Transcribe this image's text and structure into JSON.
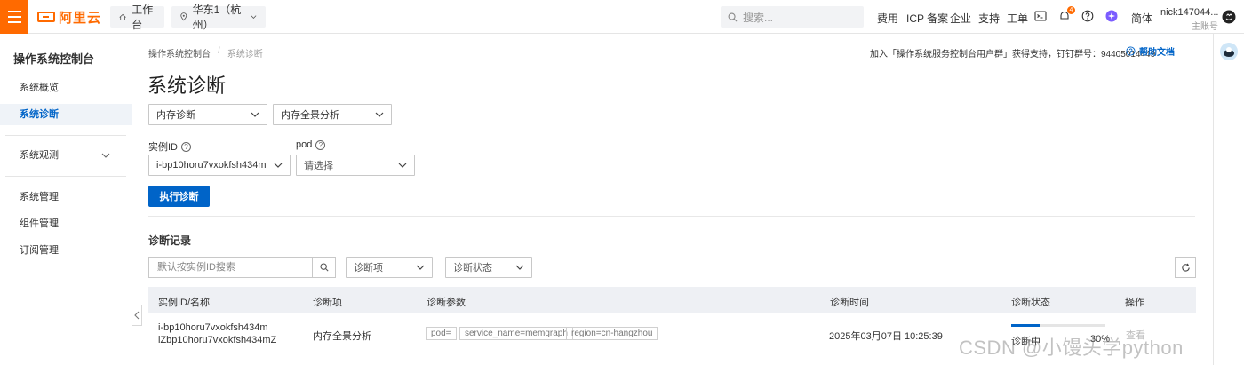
{
  "topbar": {
    "logo_text": "阿里云",
    "home_label": "工作台",
    "region_label": "华东1（杭州）",
    "search_placeholder": "搜索...",
    "links": [
      "费用",
      "ICP 备案",
      "企业",
      "支持",
      "工单"
    ],
    "notification_count": "4",
    "lang_label": "简体",
    "user_name": "nick147044...",
    "user_role": "主账号",
    "accent_color": "#ff6a00"
  },
  "sidebar": {
    "title": "操作系统控制台",
    "items": [
      {
        "label": "系统概览",
        "active": false
      },
      {
        "label": "系统诊断",
        "active": true
      },
      {
        "label": "系统观测",
        "active": false,
        "expandable": true
      },
      {
        "label": "系统管理",
        "active": false
      },
      {
        "label": "组件管理",
        "active": false
      },
      {
        "label": "订阅管理",
        "active": false
      }
    ]
  },
  "main": {
    "breadcrumb": [
      "操作系统控制台",
      "系统诊断"
    ],
    "help_text": "加入「操作系统服务控制台用户群」获得支持，钉钉群号：94405014449",
    "help_doc_label": "帮助文档",
    "title": "系统诊断",
    "diag_type": "内存诊断",
    "diag_item": "内存全景分析",
    "instance_label": "实例ID",
    "instance_value": "i-bp10horu7vxokfsh434m",
    "pod_label": "pod",
    "pod_placeholder": "请选择",
    "run_button": "执行诊断",
    "records_title": "诊断记录",
    "records_search_placeholder": "默认按实例ID搜索",
    "filter_item": "诊断项",
    "filter_status": "诊断状态",
    "table": {
      "headers": [
        "实例ID/名称",
        "诊断项",
        "诊断参数",
        "诊断时间",
        "诊断状态",
        "操作"
      ],
      "rows": [
        {
          "instance_id": "i-bp10horu7vxokfsh434m",
          "instance_name": "iZbp10horu7vxokfsh434mZ",
          "item": "内存全景分析",
          "params": [
            "pod=",
            "service_name=memgraph",
            "region=cn-hangzhou"
          ],
          "time": "2025年03月07日 10:25:39",
          "status": "诊断中",
          "progress_percent": 30,
          "progress_label": "30%",
          "action": "查看"
        }
      ]
    }
  },
  "watermark": "CSDN @小馒头学python",
  "brand_color": "#0064c8"
}
